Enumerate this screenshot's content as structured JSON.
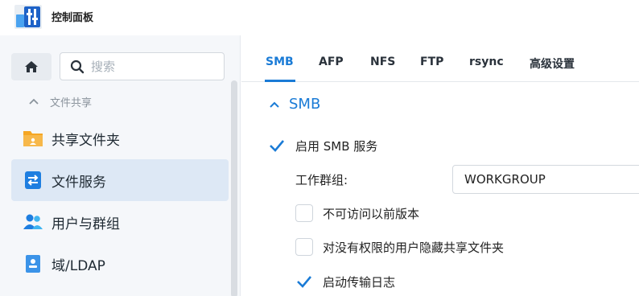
{
  "window": {
    "title": "控制面板"
  },
  "sidebar": {
    "search": {
      "placeholder": "搜索"
    },
    "section": {
      "label": "文件共享"
    },
    "items": [
      {
        "label": "共享文件夹",
        "icon": "folder-icon",
        "active": false
      },
      {
        "label": "文件服务",
        "icon": "file-services-icon",
        "active": true
      },
      {
        "label": "用户与群组",
        "icon": "users-icon",
        "active": false
      },
      {
        "label": "域/LDAP",
        "icon": "domain-icon",
        "active": false
      }
    ]
  },
  "tabs": [
    {
      "label": "SMB",
      "active": true
    },
    {
      "label": "AFP",
      "active": false
    },
    {
      "label": "NFS",
      "active": false
    },
    {
      "label": "FTP",
      "active": false
    },
    {
      "label": "rsync",
      "active": false
    },
    {
      "label": "高级设置",
      "active": false
    }
  ],
  "smb": {
    "group_title": "SMB",
    "enable": {
      "label": "启用 SMB 服务",
      "checked": true
    },
    "workgroup": {
      "label": "工作群组:",
      "value": "WORKGROUP"
    },
    "options": [
      {
        "label": "不可访问以前版本",
        "checked": false
      },
      {
        "label": "对没有权限的用户隐藏共享文件夹",
        "checked": false
      },
      {
        "label": "启动传输日志",
        "checked": true
      }
    ]
  },
  "colors": {
    "accent": "#1a7bd6",
    "active_bg": "#dde8f5",
    "sidebar_bg": "#f5f7fa"
  }
}
